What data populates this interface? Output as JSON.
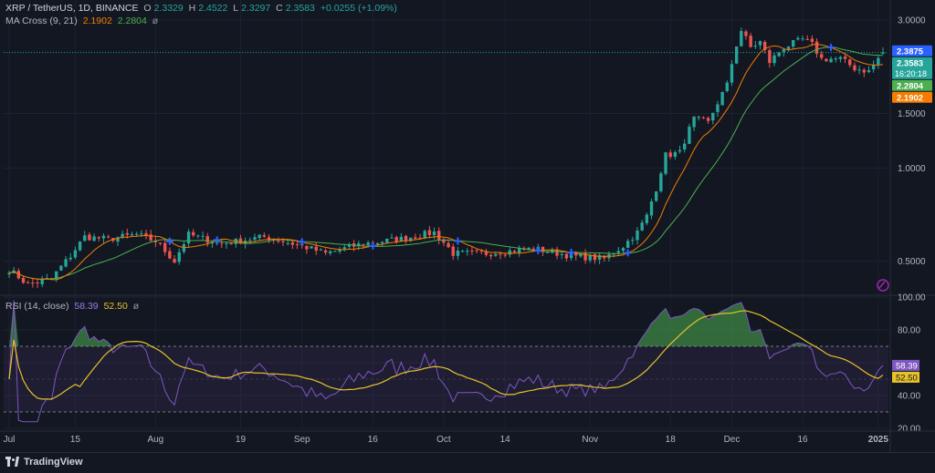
{
  "legend": {
    "symbol": "XRP / TetherUS, 1D, BINANCE",
    "o_key": "O",
    "o_val": "2.3329",
    "h_key": "H",
    "h_val": "2.4522",
    "l_key": "L",
    "l_val": "2.3297",
    "c_key": "C",
    "c_val": "2.3583",
    "change": "+0.0255 (+1.09%)",
    "ma_label": "MA Cross (9, 21)",
    "ma_fast": "2.1902",
    "ma_slow": "2.2804",
    "eye_glyph": "ø",
    "rsi_label": "RSI (14, close)",
    "rsi_val": "58.39",
    "rsi_ma": "52.50"
  },
  "brand": {
    "name": "TradingView"
  },
  "colors": {
    "background": "#131722",
    "up": "#26a69a",
    "down": "#ef5350",
    "ma_fast": "#f57c00",
    "ma_slow": "#4caf50",
    "rsi_line": "#7e57c2",
    "rsi_ma": "#e6c229",
    "cross_marker": "#2962ff",
    "price_tag_current": "#2962ff",
    "price_tag_close": "#26a69a"
  },
  "price_tags": [
    {
      "id": "tag-high",
      "value": 2.3875,
      "text": "2.3875",
      "color": "#2962ff"
    },
    {
      "id": "tag-close",
      "value": 2.3583,
      "text": "2.3583",
      "sub": "16:20:18",
      "color": "#26a69a"
    },
    {
      "id": "tag-ma-slow",
      "value": 2.2804,
      "text": "2.2804",
      "color": "#4caf50"
    },
    {
      "id": "tag-ma-fast",
      "value": 2.1902,
      "text": "2.1902",
      "color": "#f57c00"
    }
  ],
  "chart_data": [
    {
      "type": "candlestick",
      "yscale": "log",
      "ylim": [
        0.41,
        3.3
      ],
      "yticks": [
        0.5,
        1.0,
        1.5,
        3.0
      ],
      "ytick_labels": [
        "0.5000",
        "1.0000",
        "1.5000",
        "3.0000"
      ],
      "xticks": [
        {
          "label": "Jul",
          "date": "2024-07-01"
        },
        {
          "label": "15",
          "date": "2024-07-15"
        },
        {
          "label": "Aug",
          "date": "2024-08-01"
        },
        {
          "label": "19",
          "date": "2024-08-19"
        },
        {
          "label": "Sep",
          "date": "2024-09-01"
        },
        {
          "label": "16",
          "date": "2024-09-16"
        },
        {
          "label": "Oct",
          "date": "2024-10-01"
        },
        {
          "label": "14",
          "date": "2024-10-14"
        },
        {
          "label": "Nov",
          "date": "2024-11-01"
        },
        {
          "label": "18",
          "date": "2024-11-18"
        },
        {
          "label": "Dec",
          "date": "2024-12-01"
        },
        {
          "label": "16",
          "date": "2024-12-16"
        },
        {
          "label": "2025",
          "date": "2025-01-01"
        }
      ],
      "x_start": "2024-07-01",
      "x_end": "2025-01-02",
      "price_anchors": [
        [
          "2024-07-01",
          0.47
        ],
        [
          "2024-07-05",
          0.42
        ],
        [
          "2024-07-10",
          0.44
        ],
        [
          "2024-07-14",
          0.52
        ],
        [
          "2024-07-17",
          0.6
        ],
        [
          "2024-07-22",
          0.59
        ],
        [
          "2024-07-28",
          0.61
        ],
        [
          "2024-08-01",
          0.58
        ],
        [
          "2024-08-05",
          0.5
        ],
        [
          "2024-08-08",
          0.61
        ],
        [
          "2024-08-15",
          0.57
        ],
        [
          "2024-08-24",
          0.6
        ],
        [
          "2024-09-01",
          0.56
        ],
        [
          "2024-09-06",
          0.53
        ],
        [
          "2024-09-14",
          0.57
        ],
        [
          "2024-09-22",
          0.59
        ],
        [
          "2024-09-29",
          0.62
        ],
        [
          "2024-10-03",
          0.53
        ],
        [
          "2024-10-10",
          0.53
        ],
        [
          "2024-10-20",
          0.55
        ],
        [
          "2024-10-28",
          0.52
        ],
        [
          "2024-11-04",
          0.51
        ],
        [
          "2024-11-08",
          0.56
        ],
        [
          "2024-11-11",
          0.62
        ],
        [
          "2024-11-13",
          0.7
        ],
        [
          "2024-11-15",
          0.86
        ],
        [
          "2024-11-17",
          1.1
        ],
        [
          "2024-11-20",
          1.12
        ],
        [
          "2024-11-23",
          1.44
        ],
        [
          "2024-11-26",
          1.4
        ],
        [
          "2024-11-30",
          1.85
        ],
        [
          "2024-12-02",
          2.5
        ],
        [
          "2024-12-03",
          2.78
        ],
        [
          "2024-12-05",
          2.45
        ],
        [
          "2024-12-07",
          2.55
        ],
        [
          "2024-12-09",
          2.2
        ],
        [
          "2024-12-12",
          2.45
        ],
        [
          "2024-12-16",
          2.6
        ],
        [
          "2024-12-18",
          2.5
        ],
        [
          "2024-12-20",
          2.25
        ],
        [
          "2024-12-24",
          2.25
        ],
        [
          "2024-12-27",
          2.1
        ],
        [
          "2024-12-30",
          2.05
        ],
        [
          "2025-01-02",
          2.36
        ]
      ],
      "last_candle": {
        "date": "2025-01-02",
        "open": 2.3329,
        "high": 2.4522,
        "low": 2.3297,
        "close": 2.3583
      },
      "series": [
        {
          "name": "2.1902",
          "kind": "sma",
          "period": 9,
          "color": "#f57c00"
        },
        {
          "name": "2.2804",
          "kind": "sma",
          "period": 21,
          "color": "#4caf50"
        }
      ]
    },
    {
      "type": "line",
      "ylim": [
        20,
        100
      ],
      "yticks": [
        20,
        40,
        60,
        80,
        100
      ],
      "ytick_labels": [
        "20.00",
        "40.00",
        "",
        "80.00",
        "100.00"
      ],
      "band": [
        30,
        70
      ],
      "overbought_fill": "green",
      "series": [
        {
          "name": "58.39",
          "kind": "rsi",
          "period": 14,
          "color": "#7e57c2",
          "last": 58.39
        },
        {
          "name": "52.50",
          "kind": "rsi_ma",
          "period": 14,
          "color": "#e6c229",
          "last": 52.5
        }
      ]
    }
  ]
}
